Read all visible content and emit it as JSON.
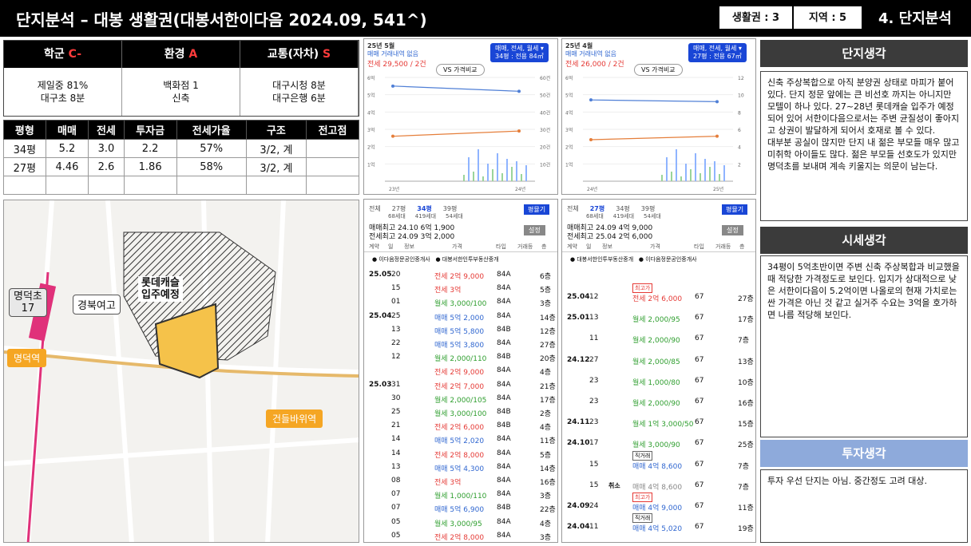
{
  "header": {
    "title": "단지분석 – 대봉 생활권(대봉서한이다음 2024.09, 541^)",
    "box1": "생활권 : 3",
    "box2": "지역 : 5",
    "section": "4. 단지분석"
  },
  "scores": [
    {
      "label": "학군",
      "grade": "C-",
      "detail1": "제일중 81%",
      "detail2": "대구초 8분"
    },
    {
      "label": "환경",
      "grade": "A",
      "detail1": "백화점 1",
      "detail2": "신축"
    },
    {
      "label": "교통(자차)",
      "grade": "S",
      "detail1": "대구시청 8분",
      "detail2": "대구은행 6분"
    }
  ],
  "price_table": {
    "headers": [
      "평형",
      "매매",
      "전세",
      "투자금",
      "전세가율",
      "구조",
      "전고점"
    ],
    "rows": [
      [
        "34평",
        "5.2",
        "3.0",
        "2.2",
        "57%",
        "3/2, 계",
        ""
      ],
      [
        "27평",
        "4.46",
        "2.6",
        "1.86",
        "58%",
        "3/2, 계",
        ""
      ]
    ]
  },
  "map": {
    "labels": {
      "school": "명덕초\n17",
      "station1": "명덕역",
      "station2": "건들바위역",
      "girls": "경북여고",
      "lotte": "롯데캐슬\n입주예정",
      "line": "명덕역"
    }
  },
  "chart1": {
    "date": "25년 5월",
    "note": "매매 거래내역 없음",
    "sub": "전세 29,500 / 2건",
    "pill": "VS 가격비교",
    "sel1": "매매, 전세, 월세",
    "sel2": "34평 : 전용 84㎡",
    "yl": [
      "6억",
      "5억",
      "4억",
      "3억",
      "2억",
      "1억"
    ],
    "yr": [
      "60건",
      "50건",
      "40건",
      "30건",
      "20건",
      "10건"
    ],
    "xl": [
      "23년",
      "24년"
    ]
  },
  "chart2": {
    "date": "25년 4월",
    "note": "매매 거래내역 없음",
    "sub": "전세 26,000 / 2건",
    "pill": "VS 가격비교",
    "sel1": "매매, 전세, 월세",
    "sel2": "27평 : 전용 67㎡",
    "yl": [
      "6억",
      "5억",
      "4억",
      "3억",
      "2억",
      "1억"
    ],
    "yr": [
      "12",
      "10",
      "8",
      "6",
      "4",
      "2"
    ],
    "xl": [
      "24년",
      "25년"
    ]
  },
  "chart_data": [
    {
      "type": "line",
      "x": [
        "23년",
        "24년"
      ],
      "series": [
        {
          "name": "매매",
          "values": [
            5.5,
            5.2
          ]
        },
        {
          "name": "전세",
          "values": [
            2.6,
            2.9
          ]
        }
      ],
      "ylim": [
        0,
        6
      ]
    },
    {
      "type": "line",
      "x": [
        "24년",
        "25년"
      ],
      "series": [
        {
          "name": "매매",
          "values": [
            4.7,
            4.6
          ]
        },
        {
          "name": "전세",
          "values": [
            2.4,
            2.6
          ]
        }
      ],
      "ylim": [
        0,
        6
      ]
    }
  ],
  "trades1": {
    "tabs": [
      "전체",
      "27평",
      "34평",
      "39평"
    ],
    "units": [
      "68세대",
      "419세대",
      "54세대"
    ],
    "btn": "평뮬기",
    "hi1": "매매최고 24.10 6억 1,900",
    "hi2": "전세최고 24.09 3억 2,000",
    "set": "설정",
    "cols": [
      "계약",
      "일",
      "정보",
      "가격",
      "타입",
      "거래등",
      "층"
    ],
    "agent1": "이다음정문공인중개사",
    "agent2": "대봉서한인투부동산중개",
    "rows": [
      [
        "25.05",
        "20",
        "전세 2억 9,000",
        "84A",
        "6층",
        "red"
      ],
      [
        "",
        "15",
        "전세 3억",
        "84A",
        "5층",
        "red"
      ],
      [
        "",
        "01",
        "월세 3,000/100",
        "84A",
        "3층",
        "grn"
      ],
      [
        "25.04",
        "25",
        "매매 5억 2,000",
        "84A",
        "14층",
        "blu"
      ],
      [
        "",
        "13",
        "매매 5억 5,800",
        "84B",
        "12층",
        "blu"
      ],
      [
        "",
        "22",
        "매매 5억 3,800",
        "84A",
        "27층",
        "blu"
      ],
      [
        "",
        "12",
        "월세 2,000/110",
        "84B",
        "20층",
        "grn"
      ],
      [
        "",
        "",
        "전세 2억 9,000",
        "84A",
        "4층",
        "red"
      ],
      [
        "25.03",
        "31",
        "전세 2억 7,000",
        "84A",
        "21층",
        "red"
      ],
      [
        "",
        "30",
        "월세 2,000/105",
        "84A",
        "17층",
        "grn"
      ],
      [
        "",
        "25",
        "월세 3,000/100",
        "84B",
        "2층",
        "grn"
      ],
      [
        "",
        "21",
        "전세 2억 6,000",
        "84B",
        "4층",
        "red"
      ],
      [
        "",
        "14",
        "매매 5억 2,020",
        "84A",
        "11층",
        "blu"
      ],
      [
        "",
        "14",
        "전세 2억 8,000",
        "84A",
        "5층",
        "red"
      ],
      [
        "",
        "13",
        "매매 5억 4,300",
        "84A",
        "14층",
        "blu"
      ],
      [
        "",
        "08",
        "전세 3억",
        "84A",
        "16층",
        "red"
      ],
      [
        "",
        "07",
        "월세 1,000/110",
        "84A",
        "3층",
        "grn"
      ],
      [
        "",
        "07",
        "매매 5억 6,900",
        "84B",
        "22층",
        "blu"
      ],
      [
        "",
        "05",
        "월세 3,000/95",
        "84A",
        "4층",
        "grn"
      ],
      [
        "",
        "05",
        "전세 2억 8,000",
        "84A",
        "3층",
        "red"
      ]
    ]
  },
  "trades2": {
    "tabs": [
      "전체",
      "27평",
      "34평",
      "39평"
    ],
    "units": [
      "68세대",
      "419세대",
      "54세대"
    ],
    "btn": "평뮬기",
    "hi1": "매매최고 24.09 4억 9,000",
    "hi2": "전세최고 25.04 2억 6,000",
    "set": "설정",
    "cols": [
      "계약",
      "일",
      "정보",
      "가격",
      "타입",
      "거래등",
      "층"
    ],
    "agent1": "대봉서한인투부동산중개",
    "agent2": "이다음정문공인중개사",
    "rows": [
      [
        "25.04",
        "12",
        "전세 2억 6,000",
        "67",
        "27층",
        "red"
      ],
      [
        "25.01",
        "13",
        "월세 2,000/95",
        "67",
        "17층",
        "grn"
      ],
      [
        "",
        "11",
        "월세 2,000/90",
        "67",
        "7층",
        "grn"
      ],
      [
        "24.12",
        "27",
        "월세 2,000/85",
        "67",
        "13층",
        "grn"
      ],
      [
        "",
        "23",
        "월세 1,000/80",
        "67",
        "10층",
        "grn"
      ],
      [
        "",
        "23",
        "월세 2,000/90",
        "67",
        "16층",
        "grn"
      ],
      [
        "24.11",
        "23",
        "월세 1억 3,000/50",
        "67",
        "15층",
        "grn"
      ],
      [
        "24.10",
        "17",
        "월세 3,000/90",
        "67",
        "25층",
        "grn"
      ],
      [
        "",
        "15",
        "매매 4억 8,600",
        "67",
        "7층",
        "blu"
      ],
      [
        "",
        "15",
        "매매 4억 8,600",
        "67",
        "7층",
        "gr"
      ],
      [
        "24.09",
        "24",
        "매매 4억 9,000",
        "67",
        "11층",
        "blu"
      ],
      [
        "24.04",
        "11",
        "매매 4억 5,020",
        "67",
        "19층",
        "blu"
      ]
    ],
    "cancel": "취소",
    "tagmax": "최고가",
    "tagdirect": "직거래"
  },
  "right": {
    "h1": "단지생각",
    "t1": "신축 주상복합으로 아직 분양권 상태로 마피가 붙어 있다. 단지 정문 앞에는 큰 비선호 까지는 아니지만 모텔이 하나 있다. 27~28년 롯데캐슬 입주가 예정되어 있어 서한이다음으로서는 주변 균질성이 좋아지고 상권이 발달하게 되어서 호재로 볼 수 있다.\n대부분 공실이 많지만 단지 내 젊은 부모들 매우 많고 미취학 아이들도 많다. 젊은 부모들 선호도가 있지만 명덕초를 보내며 계속 키울지는 의문이 남는다.",
    "h2": "시세생각",
    "t2": "34평이 5억초반이면 주변 신축 주상복합과 비교했을 때 적당한 가격정도로 보인다. 입지가 상대적으로 낮은 서한이다음이 5.2억이면 나올로의 현재 가치로는 싼 가격은 아닌 것 같고 실거주 수요는 3억을 호가하면 나름 적당해 보인다.",
    "h3": "투자생각",
    "t3": "투자 우선 단지는 아님. 중간정도 고려 대상."
  }
}
